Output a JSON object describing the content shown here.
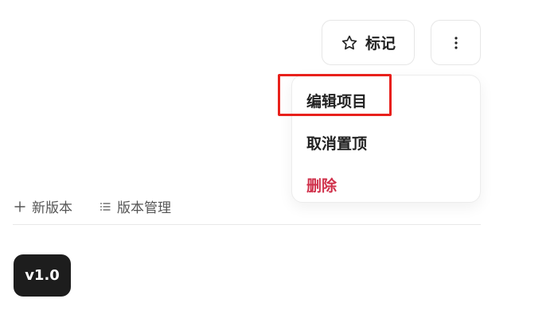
{
  "header": {
    "mark_label": "标记",
    "mark_icon": "star-outline-icon",
    "more_icon": "vertical-ellipsis-icon"
  },
  "menu": {
    "items": [
      {
        "label": "编辑项目",
        "highlighted": true
      },
      {
        "label": "取消置顶"
      },
      {
        "label": "删除",
        "color": "#d0314b"
      }
    ],
    "highlight_color": "#e8201b"
  },
  "toolbar": {
    "new_version_label": "新版本",
    "new_version_icon": "plus-icon",
    "manage_label": "版本管理",
    "manage_icon": "list-icon"
  },
  "version": {
    "badge_label": "v1.0",
    "badge_color": "#1d1d1d"
  }
}
